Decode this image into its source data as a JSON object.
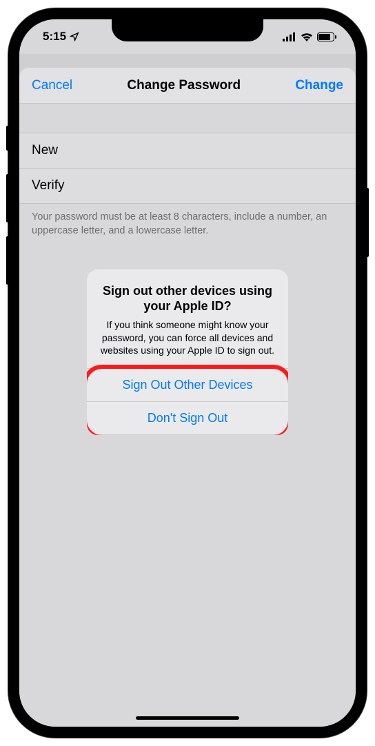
{
  "status": {
    "time": "5:15"
  },
  "nav": {
    "cancel": "Cancel",
    "title": "Change Password",
    "change": "Change"
  },
  "fields": {
    "new": "New",
    "verify": "Verify"
  },
  "hint": "Your password must be at least 8 characters, include a number, an uppercase letter, and a lowercase letter.",
  "alert": {
    "title": "Sign out other devices using your Apple ID?",
    "message": "If you think someone might know your password, you can force all devices and websites using your Apple ID to sign out.",
    "signout": "Sign Out Other Devices",
    "dont": "Don't Sign Out"
  }
}
